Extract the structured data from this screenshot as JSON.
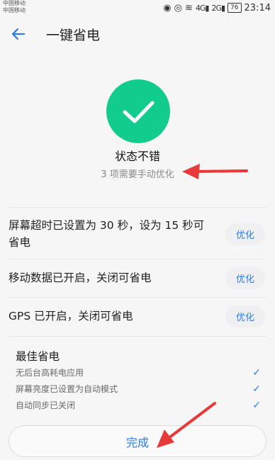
{
  "status_bar": {
    "carrier_1": "中国移动",
    "carrier_2": "中国移动",
    "network_1": "4G",
    "network_2": "2G",
    "battery": "76",
    "time": "23:14"
  },
  "app_bar": {
    "title": "一键省电",
    "back_icon": "back-arrow-icon"
  },
  "hero": {
    "icon": "check-icon",
    "icon_color": "#12cc8d",
    "status": "状态不错",
    "subtitle": "3 项需要手动优化"
  },
  "items": [
    {
      "text": "屏幕超时已设置为 30 秒，设为 15 秒可省电",
      "button": "优化"
    },
    {
      "text": "移动数据已开启，关闭可省电",
      "button": "优化"
    },
    {
      "text": "GPS 已开启，关闭可省电",
      "button": "优化"
    }
  ],
  "best": {
    "title": "最佳省电",
    "items": [
      "无后台高耗电应用",
      "屏幕亮度已设置为自动模式",
      "自动同步已关闭"
    ]
  },
  "done_button": "完成",
  "colors": {
    "accent": "#2b7ce8",
    "annotation_arrow": "#e83a3a"
  }
}
